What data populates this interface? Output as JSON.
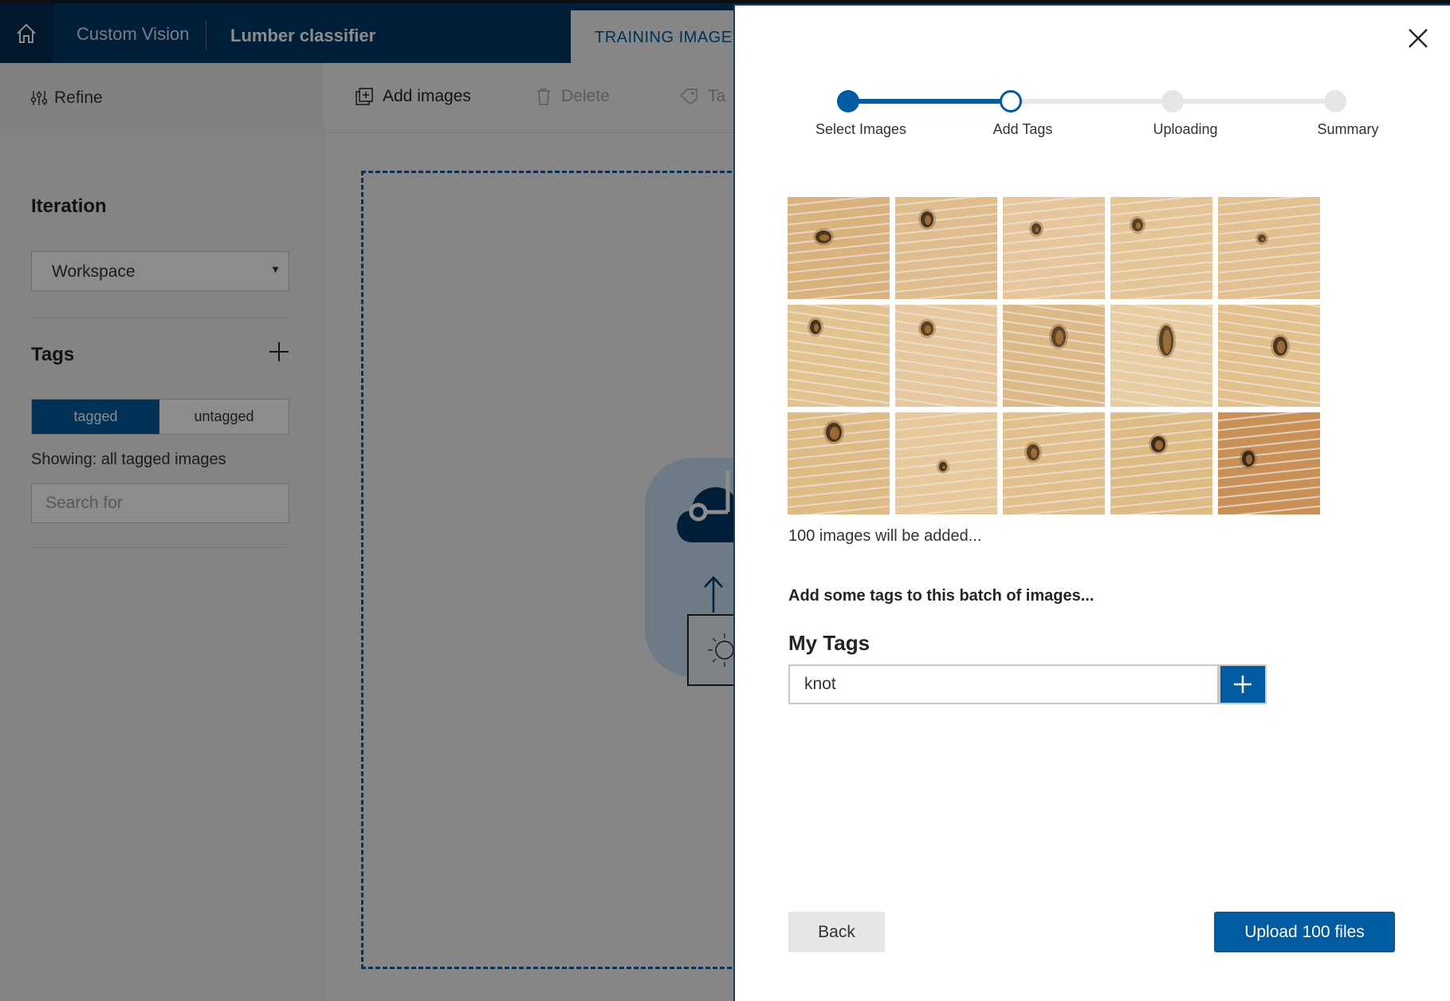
{
  "header": {
    "brand": "Custom Vision",
    "project": "Lumber classifier",
    "active_tab": "TRAINING IMAGES"
  },
  "left_panel": {
    "refine_label": "Refine",
    "iteration_title": "Iteration",
    "iteration_selected": "Workspace",
    "tags_title": "Tags",
    "toggle_tagged": "tagged",
    "toggle_untagged": "untagged",
    "showing_text": "Showing: all tagged images",
    "search_placeholder": "Search for"
  },
  "toolbar": {
    "add_images": "Add images",
    "delete": "Delete",
    "tag_partial": "Ta"
  },
  "dialog": {
    "steps": [
      {
        "label": "Select Images",
        "state": "done"
      },
      {
        "label": "Add Tags",
        "state": "current"
      },
      {
        "label": "Uploading",
        "state": "pending"
      },
      {
        "label": "Summary",
        "state": "pending"
      }
    ],
    "added_count_text": "100 images will be added...",
    "batch_prompt": "Add some tags to this batch of images...",
    "my_tags_title": "My Tags",
    "tag_input_value": "knot",
    "back_label": "Back",
    "upload_label": "Upload 100 files"
  },
  "thumbnails": [
    {
      "bg": "#d9b27e",
      "knot": "#4a3420"
    },
    {
      "bg": "#e0bd8c",
      "knot": "#4a3420"
    },
    {
      "bg": "#e6c69a",
      "knot": "#5a3f23"
    },
    {
      "bg": "#e5c596",
      "knot": "#5a3f23"
    },
    {
      "bg": "#e3c090",
      "knot": "#5a3f23"
    },
    {
      "bg": "#e2c28f",
      "knot": "#4a3420"
    },
    {
      "bg": "#e6c79e",
      "knot": "#5a3f23"
    },
    {
      "bg": "#dcb987",
      "knot": "#5b4328"
    },
    {
      "bg": "#e8cda1",
      "knot": "#5b4328"
    },
    {
      "bg": "#e3c18d",
      "knot": "#4a3420"
    },
    {
      "bg": "#dfbb86",
      "knot": "#4a3420"
    },
    {
      "bg": "#e7c99c",
      "knot": "#4a3420"
    },
    {
      "bg": "#e2c08e",
      "knot": "#5a3f23"
    },
    {
      "bg": "#dfbb86",
      "knot": "#3d2a18"
    },
    {
      "bg": "#c88f57",
      "knot": "#3d2a18"
    }
  ],
  "colors": {
    "accent": "#005ba1",
    "topbar": "#003865"
  }
}
